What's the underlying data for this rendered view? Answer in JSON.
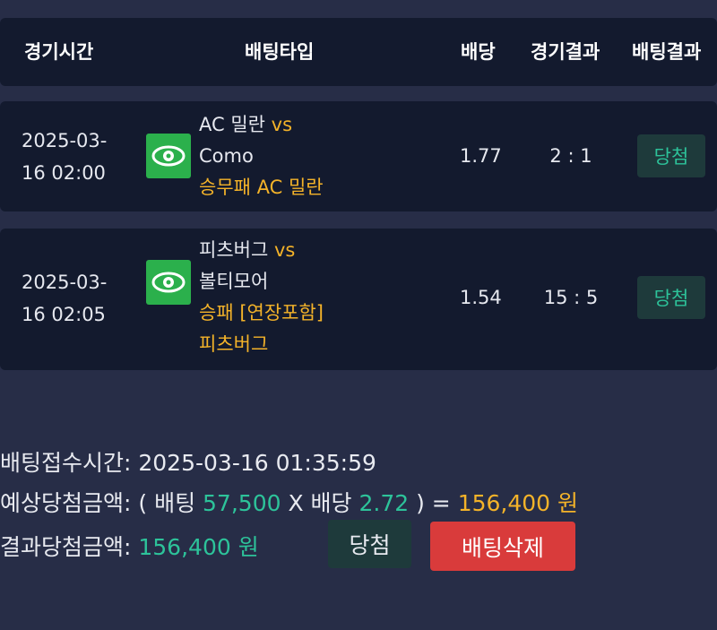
{
  "header": {
    "time": "경기시간",
    "bet_type": "배팅타입",
    "odds": "배당",
    "result": "경기결과",
    "bet_result": "배팅결과"
  },
  "rows": [
    {
      "date": "2025-03-",
      "time": "16 02:00",
      "home": "AC 밀란",
      "vs": "vs",
      "away": "Como",
      "pick_line1": "승무패 AC 밀란",
      "pick_line2": "",
      "odds": "1.77",
      "score": "2 : 1",
      "result": "당첨",
      "icon": "eye-icon"
    },
    {
      "date": "2025-03-",
      "time": "16 02:05",
      "home": "피츠버그",
      "vs": "vs",
      "away": "볼티모어",
      "pick_line1": "승패 [연장포함]",
      "pick_line2": "피츠버그",
      "odds": "1.54",
      "score": "15 : 5",
      "result": "당첨",
      "icon": "eye-icon"
    }
  ],
  "summary": {
    "received_label": "배팅접수시간: ",
    "received_value": "2025-03-16 01:35:59",
    "expected_label": "예상당첨금액: ( 배팅 ",
    "bet_amount": "57,500",
    "x_label": " X 배당 ",
    "total_odds": "2.72",
    "close_eq": " ) = ",
    "expected_amount": "156,400 원",
    "result_label": "결과당첨금액: ",
    "result_amount": "156,400 원",
    "win_button": "당첨",
    "delete_button": "배팅삭제"
  },
  "colors": {
    "background": "#272d47",
    "panel": "#131a2e",
    "gold": "#f4b329",
    "teal": "#2dc39a",
    "green": "#2bb04c",
    "red": "#d93b3b"
  }
}
